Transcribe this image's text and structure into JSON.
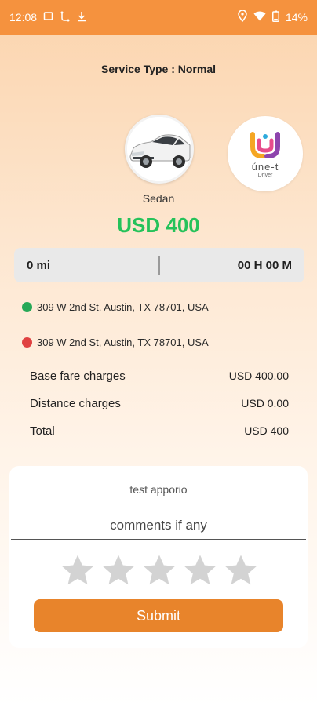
{
  "status_bar": {
    "time": "12:08",
    "battery": "14%",
    "icons": [
      "screen-icon",
      "route-icon",
      "download-icon",
      "location-icon",
      "wifi-icon",
      "battery-icon"
    ]
  },
  "service_type": "Service Type : Normal",
  "vehicle": {
    "type": "Sedan",
    "price": "USD 400"
  },
  "logo": {
    "text": "úne-t",
    "sub": "Driver"
  },
  "trip": {
    "distance": "0 mi",
    "duration": "00 H 00 M",
    "pickup": "309 W 2nd St, Austin, TX 78701, USA",
    "dropoff": "309 W 2nd St, Austin, TX 78701, USA"
  },
  "fares": [
    {
      "label": "Base fare charges",
      "value": "USD 400.00"
    },
    {
      "label": "Distance charges",
      "value": "USD 0.00"
    },
    {
      "label": "Total",
      "value": "USD 400"
    }
  ],
  "rating": {
    "name": "test apporio",
    "comment_placeholder": "comments if any",
    "stars": 5,
    "submit_label": "Submit"
  },
  "colors": {
    "accent": "#f5923e",
    "submit": "#e8842b",
    "price": "#25c25a",
    "pickup_dot": "#27a857",
    "dropoff_dot": "#e04141",
    "star": "#d3d3d3"
  }
}
